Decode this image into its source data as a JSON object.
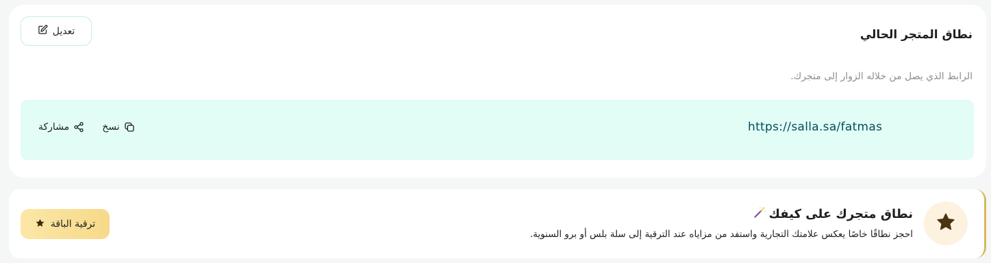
{
  "domain_card": {
    "title": "نطاق المتجر الحالي",
    "description": "الرابط الذي يصل من خلاله الزوار إلى متجرك.",
    "edit_label": "تعديل",
    "url": "https://salla.sa/fatmas",
    "copy_label": "نسخ",
    "share_label": "مشاركة"
  },
  "promo_card": {
    "title": "نطاق متجرك على كيفك",
    "description": "احجز نطاقًا خاصًا يعكس علامتك التجارية واستفد من مزاياه عند الترقية إلى سلة بلس أو برو السنوية.",
    "upgrade_label": "ترقية الباقة"
  },
  "icons": {
    "edit": "edit-icon",
    "copy": "copy-icon",
    "share": "share-icon",
    "star": "star-icon",
    "magic": "magic-wand-icon"
  },
  "colors": {
    "accent_bg": "#e2fcf6",
    "url_color": "#004d5a",
    "gold": "#f7d989",
    "star_dark": "#4a3410"
  }
}
